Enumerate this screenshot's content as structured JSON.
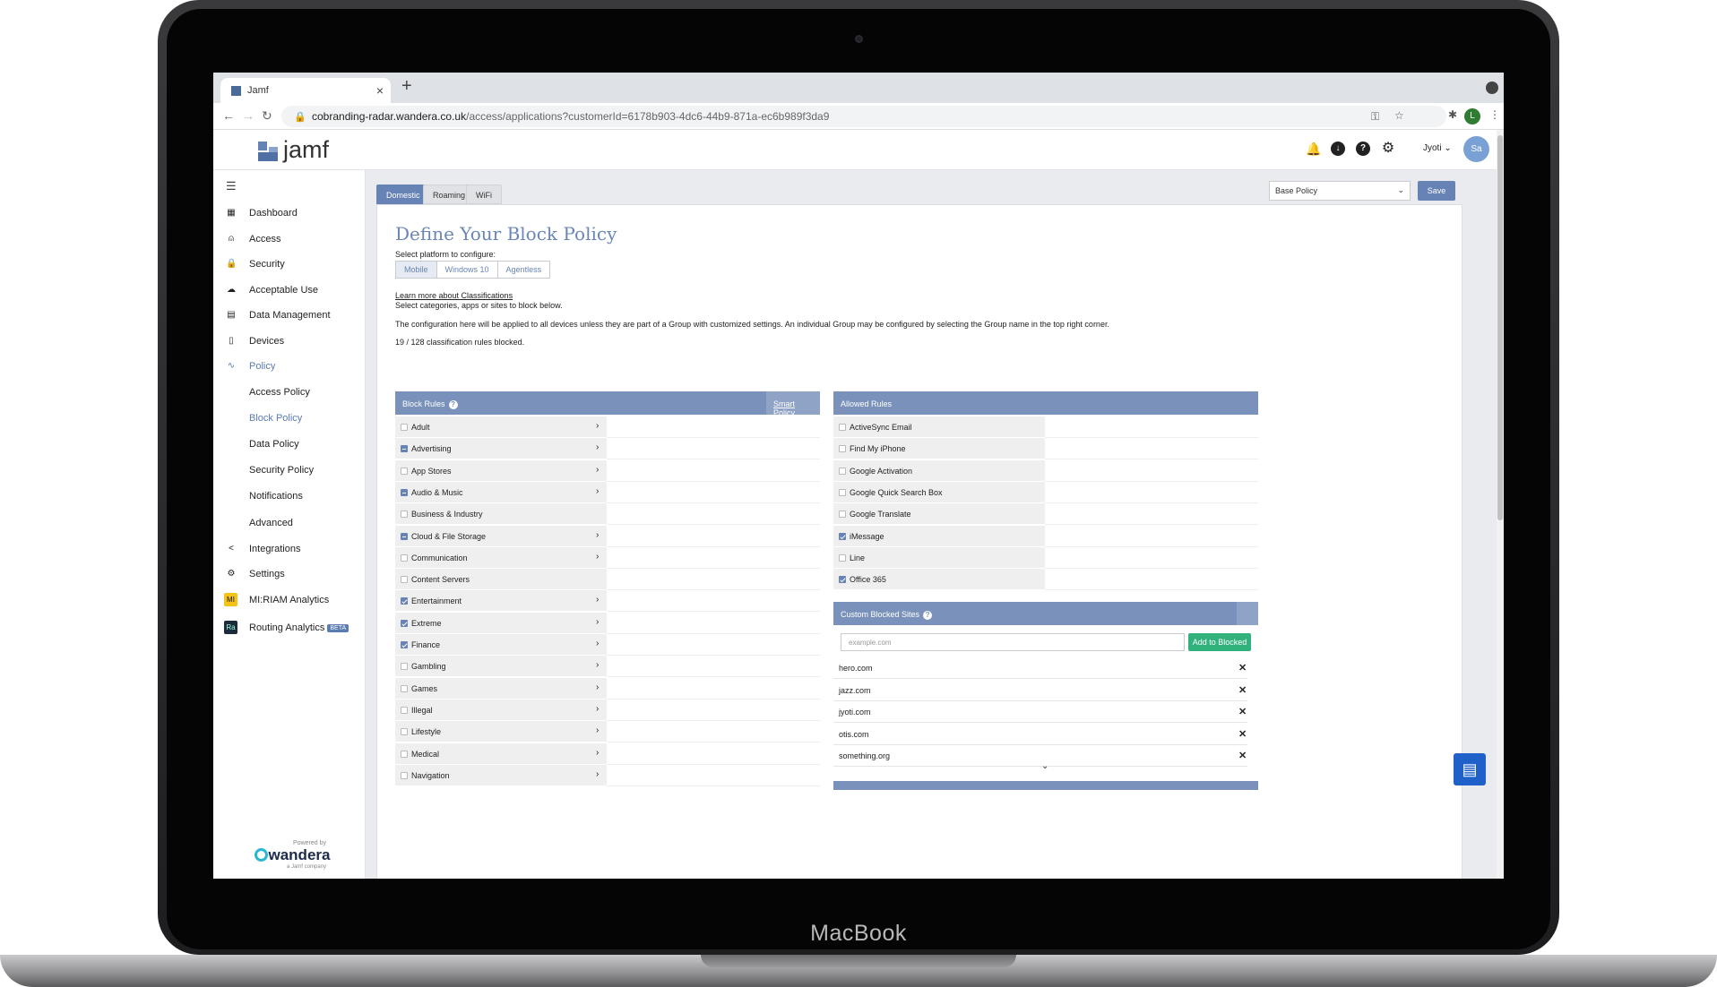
{
  "device": {
    "brand": "MacBook"
  },
  "browser": {
    "tab_title": "Jamf",
    "tab_close": "×",
    "new_tab": "+",
    "url_domain": "cobranding-radar.wandera.co.uk",
    "url_path": "/access/applications?customerId=6178b903-4dc6-44b9-871a-ec6b989f3da9",
    "profile_initial": "L"
  },
  "header": {
    "logo_text": "jamf",
    "user_name": "Jyoti",
    "user_initials": "Sa"
  },
  "sidebar": {
    "items": [
      {
        "label": "Dashboard",
        "icon": "dashboard-icon"
      },
      {
        "label": "Access",
        "icon": "access-icon"
      },
      {
        "label": "Security",
        "icon": "lock-icon"
      },
      {
        "label": "Acceptable Use",
        "icon": "cloud-icon"
      },
      {
        "label": "Data Management",
        "icon": "data-icon"
      },
      {
        "label": "Devices",
        "icon": "devices-icon"
      },
      {
        "label": "Policy",
        "icon": "policy-icon"
      },
      {
        "label": "Access Policy"
      },
      {
        "label": "Block Policy"
      },
      {
        "label": "Data Policy"
      },
      {
        "label": "Security Policy"
      },
      {
        "label": "Notifications"
      },
      {
        "label": "Advanced"
      },
      {
        "label": "Integrations",
        "icon": "share-icon"
      },
      {
        "label": "Settings",
        "icon": "gear-icon"
      },
      {
        "label": "MI:RIAM Analytics",
        "badge": "MI"
      },
      {
        "label": "Routing Analytics",
        "badge": "Ra",
        "tag": "BETA"
      }
    ],
    "powered_by": "Powered by",
    "wandera_logo": "wandera",
    "wandera_sub": "a Jamf company"
  },
  "tabs": [
    "Domestic",
    "Roaming",
    "WiFi"
  ],
  "policy_select": "Base Policy",
  "save_label": "Save",
  "page": {
    "title": "Define Your Block Policy",
    "platform_label": "Select platform to configure:",
    "platforms": [
      "Mobile",
      "Windows 10",
      "Agentless"
    ],
    "learn_more": "Learn more about Classifications",
    "select_hint": "Select categories, apps or sites to block below.",
    "config_note": "The configuration here will be applied to all devices unless they are part of a Group with customized settings. An individual Group may be configured by selecting the Group name in the top right corner.",
    "rules_count": "19 / 128 classification rules blocked."
  },
  "block_rules": {
    "title": "Block Rules",
    "smart_policy": "Smart Policy",
    "items": [
      {
        "label": "Adult",
        "state": "none",
        "chevron": true
      },
      {
        "label": "Advertising",
        "state": "partial",
        "chevron": true
      },
      {
        "label": "App Stores",
        "state": "none",
        "chevron": true
      },
      {
        "label": "Audio & Music",
        "state": "partial",
        "chevron": true
      },
      {
        "label": "Business & Industry",
        "state": "none",
        "chevron": false
      },
      {
        "label": "Cloud & File Storage",
        "state": "partial",
        "chevron": true
      },
      {
        "label": "Communication",
        "state": "none",
        "chevron": true
      },
      {
        "label": "Content Servers",
        "state": "none",
        "chevron": false
      },
      {
        "label": "Entertainment",
        "state": "checked",
        "chevron": true
      },
      {
        "label": "Extreme",
        "state": "checked",
        "chevron": true
      },
      {
        "label": "Finance",
        "state": "checked",
        "chevron": true
      },
      {
        "label": "Gambling",
        "state": "none",
        "chevron": true
      },
      {
        "label": "Games",
        "state": "none",
        "chevron": true
      },
      {
        "label": "Illegal",
        "state": "none",
        "chevron": true
      },
      {
        "label": "Lifestyle",
        "state": "none",
        "chevron": true
      },
      {
        "label": "Medical",
        "state": "none",
        "chevron": true
      },
      {
        "label": "Navigation",
        "state": "none",
        "chevron": true
      }
    ]
  },
  "allowed_rules": {
    "title": "Allowed Rules",
    "items": [
      {
        "label": "ActiveSync Email",
        "state": "none"
      },
      {
        "label": "Find My iPhone",
        "state": "none"
      },
      {
        "label": "Google Activation",
        "state": "none"
      },
      {
        "label": "Google Quick Search Box",
        "state": "none"
      },
      {
        "label": "Google Translate",
        "state": "none"
      },
      {
        "label": "iMessage",
        "state": "checked"
      },
      {
        "label": "Line",
        "state": "none"
      },
      {
        "label": "Office 365",
        "state": "checked"
      }
    ]
  },
  "custom_blocked": {
    "title": "Custom Blocked Sites",
    "placeholder": "example.com",
    "add_label": "Add to Blocked",
    "sites": [
      "hero.com",
      "jazz.com",
      "jyoti.com",
      "otis.com",
      "something.org"
    ]
  },
  "colors": {
    "accent": "#6783b5",
    "header": "#7a92bb",
    "add": "#31b17b",
    "fab": "#1f61c8"
  }
}
